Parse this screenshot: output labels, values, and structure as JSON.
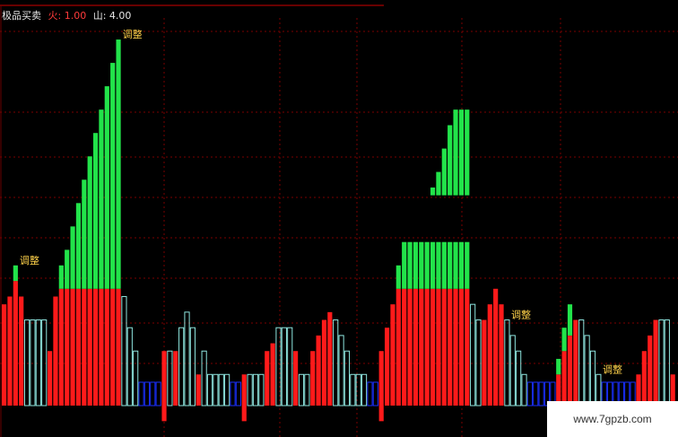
{
  "header": {
    "indicator_name": "极品买卖",
    "fire_label": "火: 1.00",
    "mountain_label": "山: 4.00"
  },
  "watermark": "www.7gpzb.com",
  "colors": {
    "background": "#000000",
    "red": "#ff1a1a",
    "green": "#22e34a",
    "cyan": "#8fe7e0",
    "blue": "#1a2fff",
    "grid": "#7a0000",
    "tag": "#ffd24a"
  },
  "chart_data": {
    "type": "bar",
    "title": "",
    "xlabel": "",
    "ylabel": "",
    "grid": true,
    "ylim": [
      0,
      100
    ],
    "annotations": [
      {
        "text": "调整",
        "bar": 2
      },
      {
        "text": "调整",
        "bar": 20
      },
      {
        "text": "调整",
        "bar": 88
      },
      {
        "text": "调整",
        "bar": 104
      }
    ],
    "series": [
      {
        "name": "",
        "values": [
          {
            "i": 0,
            "r": [
              0,
              26
            ]
          },
          {
            "i": 1,
            "r": [
              0,
              28
            ]
          },
          {
            "i": 2,
            "r": [
              0,
              32
            ],
            "g": [
              32,
              36
            ]
          },
          {
            "i": 3,
            "r": [
              0,
              28
            ]
          },
          {
            "i": 4,
            "c": [
              0,
              22
            ]
          },
          {
            "i": 5,
            "c": [
              0,
              22
            ]
          },
          {
            "i": 6,
            "c": [
              0,
              22
            ]
          },
          {
            "i": 7,
            "c": [
              0,
              22
            ]
          },
          {
            "i": 8,
            "r": [
              0,
              14
            ]
          },
          {
            "i": 9,
            "r": [
              0,
              28
            ]
          },
          {
            "i": 10,
            "r": [
              0,
              30
            ],
            "g": [
              30,
              36
            ]
          },
          {
            "i": 11,
            "r": [
              0,
              30
            ],
            "g": [
              30,
              40
            ]
          },
          {
            "i": 12,
            "r": [
              0,
              30
            ],
            "g": [
              30,
              46
            ]
          },
          {
            "i": 13,
            "r": [
              0,
              30
            ],
            "g": [
              30,
              52
            ]
          },
          {
            "i": 14,
            "r": [
              0,
              30
            ],
            "g": [
              30,
              58
            ]
          },
          {
            "i": 15,
            "r": [
              0,
              30
            ],
            "g": [
              30,
              64
            ]
          },
          {
            "i": 16,
            "r": [
              0,
              30
            ],
            "g": [
              30,
              70
            ]
          },
          {
            "i": 17,
            "r": [
              0,
              30
            ],
            "g": [
              30,
              76
            ]
          },
          {
            "i": 18,
            "r": [
              0,
              30
            ],
            "g": [
              30,
              82
            ]
          },
          {
            "i": 19,
            "r": [
              0,
              30
            ],
            "g": [
              30,
              88
            ]
          },
          {
            "i": 20,
            "r": [
              0,
              30
            ],
            "g": [
              30,
              94
            ]
          },
          {
            "i": 21,
            "c": [
              0,
              28
            ]
          },
          {
            "i": 22,
            "c": [
              0,
              20
            ]
          },
          {
            "i": 23,
            "c": [
              0,
              14
            ]
          },
          {
            "i": 24,
            "b": [
              0,
              6
            ]
          },
          {
            "i": 25,
            "b": [
              0,
              6
            ]
          },
          {
            "i": 26,
            "b": [
              0,
              6
            ]
          },
          {
            "i": 27,
            "b": [
              0,
              6
            ]
          },
          {
            "i": 28,
            "r": [
              -4,
              14
            ]
          },
          {
            "i": 29,
            "c": [
              0,
              14
            ]
          },
          {
            "i": 30,
            "r": [
              0,
              14
            ]
          },
          {
            "i": 31,
            "c": [
              0,
              20
            ]
          },
          {
            "i": 32,
            "c": [
              0,
              24
            ]
          },
          {
            "i": 33,
            "c": [
              0,
              20
            ]
          },
          {
            "i": 34,
            "r": [
              0,
              8
            ]
          },
          {
            "i": 35,
            "c": [
              0,
              14
            ]
          },
          {
            "i": 36,
            "c": [
              0,
              8
            ]
          },
          {
            "i": 37,
            "c": [
              0,
              8
            ]
          },
          {
            "i": 38,
            "c": [
              0,
              8
            ]
          },
          {
            "i": 39,
            "c": [
              0,
              8
            ]
          },
          {
            "i": 40,
            "b": [
              0,
              6
            ]
          },
          {
            "i": 41,
            "b": [
              0,
              6
            ]
          },
          {
            "i": 42,
            "r": [
              -4,
              8
            ]
          },
          {
            "i": 43,
            "c": [
              0,
              8
            ]
          },
          {
            "i": 44,
            "c": [
              0,
              8
            ]
          },
          {
            "i": 45,
            "c": [
              0,
              8
            ]
          },
          {
            "i": 46,
            "r": [
              0,
              14
            ]
          },
          {
            "i": 47,
            "r": [
              0,
              16
            ]
          },
          {
            "i": 48,
            "c": [
              0,
              20
            ]
          },
          {
            "i": 49,
            "c": [
              0,
              20
            ]
          },
          {
            "i": 50,
            "c": [
              0,
              20
            ]
          },
          {
            "i": 51,
            "r": [
              0,
              14
            ]
          },
          {
            "i": 52,
            "c": [
              0,
              8
            ]
          },
          {
            "i": 53,
            "c": [
              0,
              8
            ]
          },
          {
            "i": 54,
            "r": [
              0,
              14
            ]
          },
          {
            "i": 55,
            "r": [
              0,
              18
            ]
          },
          {
            "i": 56,
            "r": [
              0,
              22
            ]
          },
          {
            "i": 57,
            "r": [
              0,
              24
            ]
          },
          {
            "i": 58,
            "c": [
              0,
              22
            ]
          },
          {
            "i": 59,
            "c": [
              0,
              18
            ]
          },
          {
            "i": 60,
            "c": [
              0,
              14
            ]
          },
          {
            "i": 61,
            "c": [
              0,
              8
            ]
          },
          {
            "i": 62,
            "c": [
              0,
              8
            ]
          },
          {
            "i": 63,
            "c": [
              0,
              8
            ]
          },
          {
            "i": 64,
            "b": [
              0,
              6
            ]
          },
          {
            "i": 65,
            "b": [
              0,
              6
            ]
          },
          {
            "i": 66,
            "r": [
              -4,
              14
            ]
          },
          {
            "i": 67,
            "r": [
              0,
              20
            ]
          },
          {
            "i": 68,
            "r": [
              0,
              26
            ]
          },
          {
            "i": 69,
            "r": [
              0,
              30
            ],
            "g": [
              30,
              36
            ]
          },
          {
            "i": 70,
            "r": [
              0,
              30
            ],
            "g": [
              30,
              42
            ]
          },
          {
            "i": 71,
            "r": [
              0,
              30
            ],
            "g": [
              30,
              42
            ]
          },
          {
            "i": 72,
            "r": [
              0,
              30
            ],
            "g": [
              30,
              42
            ]
          },
          {
            "i": 73,
            "r": [
              0,
              30
            ],
            "g": [
              30,
              42
            ]
          },
          {
            "i": 74,
            "r": [
              0,
              30
            ],
            "g": [
              30,
              42
            ]
          },
          {
            "i": 75,
            "r": [
              0,
              30
            ],
            "g": [
              30,
              42
            ]
          },
          {
            "i": 76,
            "r": [
              0,
              30
            ],
            "g": [
              30,
              42
            ]
          },
          {
            "i": 77,
            "r": [
              0,
              30
            ],
            "g": [
              30,
              42
            ]
          },
          {
            "i": 78,
            "r": [
              0,
              30
            ],
            "g": [
              30,
              42
            ]
          },
          {
            "i": 79,
            "r": [
              0,
              30
            ],
            "g": [
              30,
              42
            ]
          },
          {
            "i": 80,
            "r": [
              0,
              30
            ],
            "g": [
              30,
              42
            ]
          },
          {
            "i": 81,
            "r": [
              0,
              30
            ],
            "g": [
              30,
              42
            ]
          },
          {
            "i": 82,
            "c": [
              0,
              26
            ]
          },
          {
            "i": 83,
            "c": [
              0,
              22
            ]
          },
          {
            "i": 84,
            "r": [
              0,
              22
            ]
          },
          {
            "i": 85,
            "r": [
              0,
              26
            ]
          },
          {
            "i": 86,
            "r": [
              0,
              30
            ]
          },
          {
            "i": 87,
            "r": [
              0,
              26
            ]
          },
          {
            "i": 88,
            "c": [
              0,
              22
            ]
          },
          {
            "i": 89,
            "c": [
              0,
              18
            ]
          },
          {
            "i": 90,
            "c": [
              0,
              14
            ]
          },
          {
            "i": 91,
            "c": [
              0,
              8
            ]
          },
          {
            "i": 92,
            "b": [
              0,
              6
            ]
          },
          {
            "i": 93,
            "b": [
              0,
              6
            ]
          },
          {
            "i": 94,
            "b": [
              0,
              6
            ]
          },
          {
            "i": 95,
            "b": [
              0,
              6
            ]
          },
          {
            "i": 96,
            "b": [
              0,
              6
            ]
          },
          {
            "i": 97,
            "r": [
              -4,
              8
            ],
            "g": [
              8,
              12
            ]
          },
          {
            "i": 98,
            "r": [
              0,
              14
            ],
            "g": [
              14,
              20
            ]
          },
          {
            "i": 99,
            "r": [
              0,
              18
            ],
            "g": [
              18,
              26
            ]
          },
          {
            "i": 100,
            "r": [
              0,
              22
            ]
          },
          {
            "i": 101,
            "c": [
              0,
              22
            ]
          },
          {
            "i": 102,
            "c": [
              0,
              18
            ]
          },
          {
            "i": 103,
            "c": [
              0,
              14
            ]
          },
          {
            "i": 104,
            "c": [
              0,
              8
            ]
          },
          {
            "i": 105,
            "b": [
              0,
              6
            ]
          },
          {
            "i": 106,
            "b": [
              0,
              6
            ]
          },
          {
            "i": 107,
            "b": [
              0,
              6
            ]
          },
          {
            "i": 108,
            "b": [
              0,
              6
            ]
          },
          {
            "i": 109,
            "b": [
              0,
              6
            ]
          },
          {
            "i": 110,
            "b": [
              0,
              6
            ]
          },
          {
            "i": 111,
            "r": [
              0,
              8
            ]
          },
          {
            "i": 112,
            "r": [
              0,
              14
            ]
          },
          {
            "i": 113,
            "r": [
              0,
              18
            ]
          },
          {
            "i": 114,
            "r": [
              0,
              22
            ]
          },
          {
            "i": 115,
            "c": [
              0,
              22
            ]
          },
          {
            "i": 116,
            "c": [
              0,
              22
            ]
          },
          {
            "i": 117,
            "r": [
              0,
              8
            ]
          }
        ],
        "floating_green": [
          {
            "i": 75,
            "g": [
              54,
              56
            ]
          },
          {
            "i": 76,
            "g": [
              54,
              60
            ]
          },
          {
            "i": 77,
            "g": [
              54,
              66
            ]
          },
          {
            "i": 78,
            "g": [
              54,
              72
            ]
          },
          {
            "i": 79,
            "g": [
              54,
              76
            ]
          },
          {
            "i": 80,
            "g": [
              54,
              76
            ]
          },
          {
            "i": 81,
            "g": [
              54,
              76
            ]
          }
        ]
      }
    ]
  }
}
